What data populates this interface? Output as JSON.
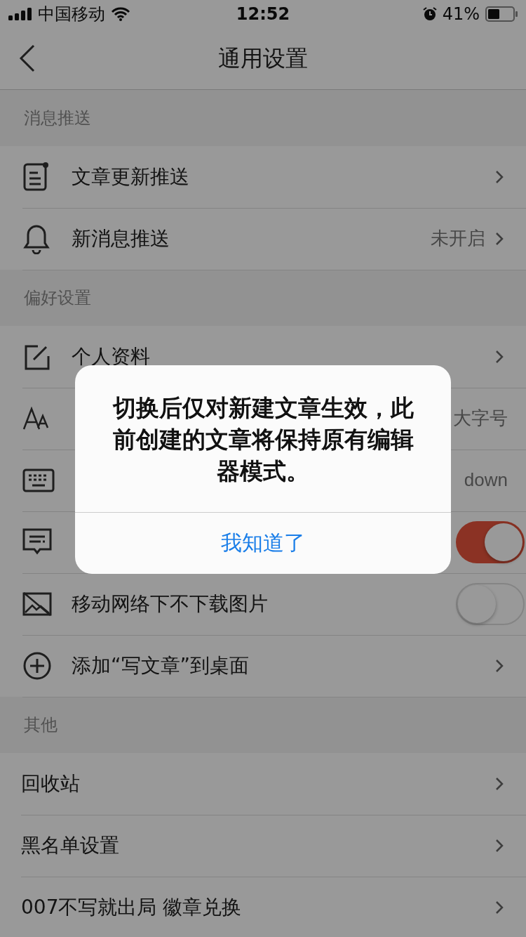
{
  "status_bar": {
    "carrier": "中国移动",
    "time": "12:52",
    "battery": "41%"
  },
  "nav": {
    "title": "通用设置"
  },
  "sections": [
    {
      "title": "消息推送",
      "rows": [
        {
          "kind": "link",
          "label": "文章更新推送"
        },
        {
          "kind": "link",
          "label": "新消息推送",
          "value": "未开启"
        }
      ]
    },
    {
      "title": "偏好设置",
      "rows": [
        {
          "kind": "link",
          "label": "个人资料"
        },
        {
          "kind": "value",
          "value": "大字号"
        },
        {
          "kind": "value",
          "value": "down"
        },
        {
          "kind": "toggle",
          "on": true
        },
        {
          "kind": "toggle",
          "label": "移动网络下不下载图片",
          "on": false
        },
        {
          "kind": "link",
          "label": "添加“写文章”到桌面"
        }
      ]
    },
    {
      "title": "其他",
      "rows": [
        {
          "kind": "link",
          "label": "回收站"
        },
        {
          "kind": "link",
          "label": "黑名单设置"
        },
        {
          "kind": "link",
          "label": "007不写就出局 徽章兑换"
        }
      ]
    }
  ],
  "dialog": {
    "message": "切换后仅对新建文章生效，此前创建的文章将保持原有编辑器模式。",
    "button": "我知道了"
  }
}
